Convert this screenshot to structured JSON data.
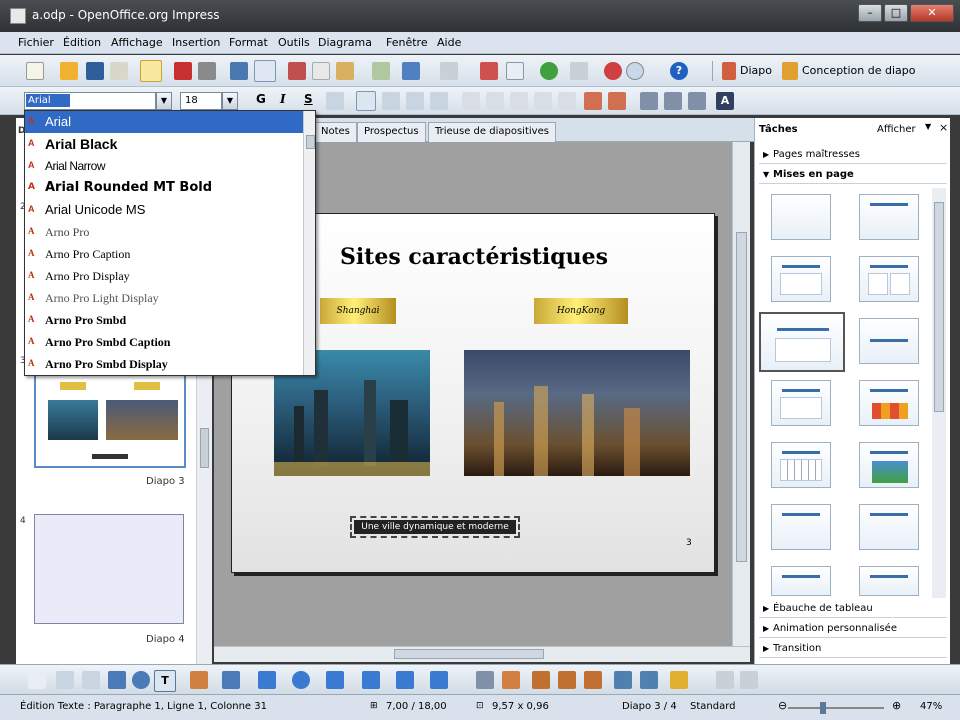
{
  "window": {
    "title": "a.odp - OpenOffice.org Impress"
  },
  "menu": [
    "Fichier",
    "Édition",
    "Affichage",
    "Insertion",
    "Format",
    "Outils",
    "Diagrama",
    "Fenêtre",
    "Aide"
  ],
  "toolbar1": {
    "diapo_label": "Diapo",
    "conception_label": "Conception de diapo"
  },
  "format_bar": {
    "font_value": "Arial",
    "size_value": "18",
    "bold": "G",
    "italic": "I",
    "strike": "S"
  },
  "font_dropdown": {
    "items": [
      "Arial",
      "Arial Black",
      "Arial Narrow",
      "Arial Rounded MT Bold",
      "Arial Unicode MS",
      "Arno Pro",
      "Arno Pro Caption",
      "Arno Pro Display",
      "Arno Pro Light Display",
      "Arno Pro Smbd",
      "Arno Pro Smbd Caption",
      "Arno Pro Smbd Display"
    ],
    "selected": "Arial"
  },
  "slides_pane": {
    "header": "D",
    "row_numbers": [
      "2",
      "3",
      "4"
    ],
    "slide3_label": "Diapo 3",
    "slide4_label": "Diapo 4",
    "slide4_number": "4"
  },
  "view_tabs": [
    "Notes",
    "Prospectus",
    "Trieuse de diapositives"
  ],
  "slide": {
    "title": "Sites caractéristiques",
    "box_left": "Shanghai",
    "box_right": "HongKong",
    "caption": "Une ville dynamique et moderne",
    "page_number": "3"
  },
  "tasks_pane": {
    "title": "Tâches",
    "view_label": "Afficher",
    "sections_top": [
      "Pages maîtresses",
      "Mises en page"
    ],
    "sections_bottom": [
      "Ébauche de tableau",
      "Animation personnalisée",
      "Transition"
    ]
  },
  "status_bar": {
    "mode": "Édition Texte : Paragraphe 1, Ligne 1, Colonne 31",
    "position": "7,00 / 18,00",
    "size": "9,57 x 0,96",
    "slide": "Diapo 3 / 4",
    "master": "Standard",
    "zoom": "47%"
  },
  "colors": {
    "selection": "#316ac5",
    "gold": "#e8d050"
  }
}
